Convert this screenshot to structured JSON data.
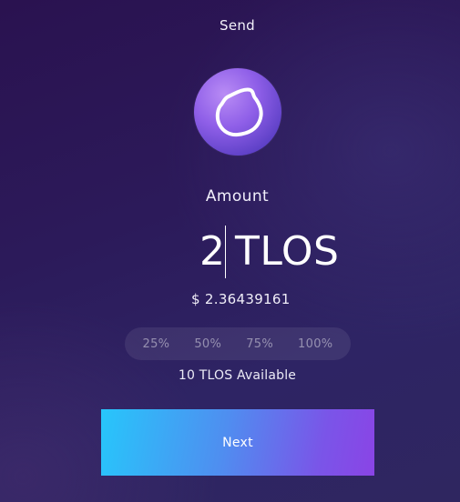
{
  "header": {
    "title": "Send"
  },
  "token": {
    "icon": "telos-logo-icon",
    "colors": {
      "logo_light": "#b98cf5",
      "logo_dark": "#4a36b0"
    }
  },
  "amount": {
    "label": "Amount",
    "value": "2",
    "symbol": "TLOS",
    "usd_value": "$ 2.36439161"
  },
  "percent_buttons": [
    {
      "label": "25%"
    },
    {
      "label": "50%"
    },
    {
      "label": "75%"
    },
    {
      "label": "100%"
    }
  ],
  "available_text": "10 TLOS Available",
  "next_button": {
    "label": "Next",
    "gradient_start": "#27c6fb",
    "gradient_end": "#8a44e6"
  }
}
